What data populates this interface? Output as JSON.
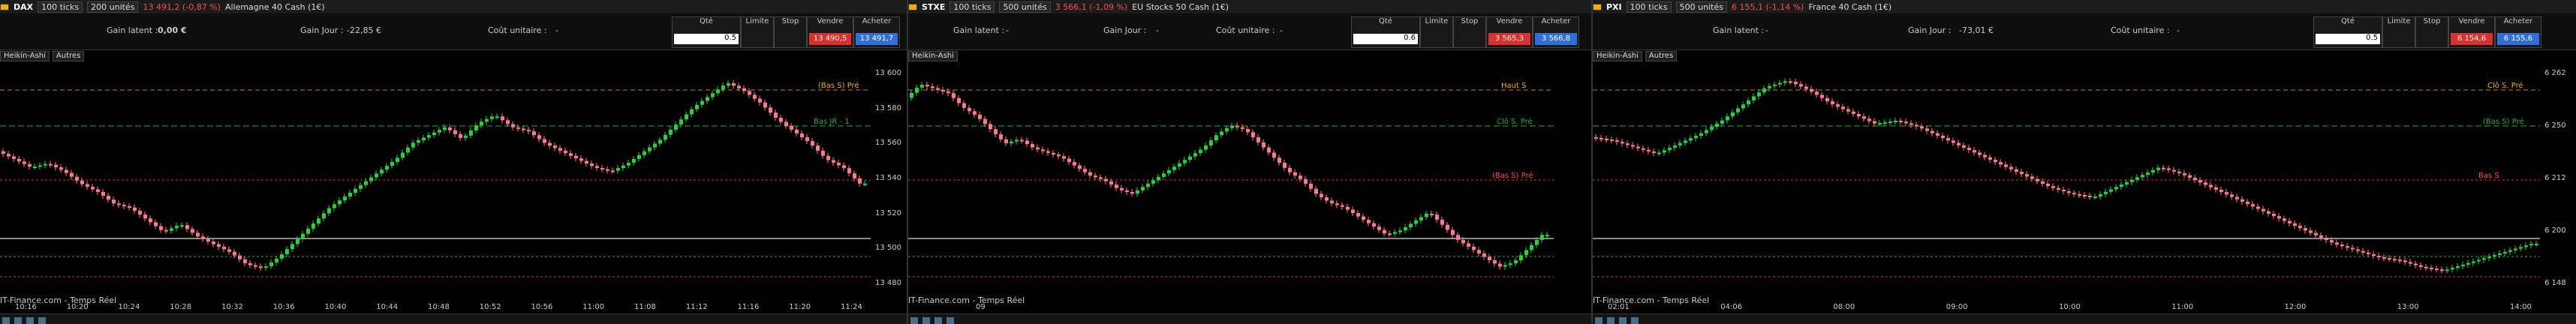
{
  "panels": [
    {
      "symbol": "DAX",
      "ticks": "100 ticks",
      "units": "200 unités",
      "quote": "13 491,2 (-0,87 %)",
      "instrument": "Allemagne 40 Cash (1€)",
      "gain_latent_label": "Gain latent :",
      "gain_latent": "0,00 €",
      "gain_jour_label": "Gain Jour :",
      "gain_jour": "-22,85 €",
      "cout_label": "Coût unitaire :",
      "cout": "-",
      "qte_label": "Qté",
      "qte": "0.5",
      "limite": "Limite",
      "stop": "Stop",
      "vendre": "Vendre",
      "acheter": "Acheter",
      "vendre_price": "13 490,5",
      "acheter_price": "13 491,7",
      "tab1": "Heikin-Ashi",
      "tab2": "Autres",
      "footer": "IT-Finance.com - Temps Réel",
      "times": [
        "10:16",
        "10:20",
        "10:24",
        "10:28",
        "10:32",
        "10:36",
        "10:40",
        "10:44",
        "10:48",
        "10:52",
        "10:56",
        "11:00",
        "11:08",
        "11:12",
        "11:16",
        "11:20",
        "11:24"
      ],
      "prices": [
        "13 600",
        "13 580",
        "13 560",
        "13 540",
        "13 520",
        "13 500",
        "13 480"
      ],
      "annotations": [
        "(Bas S) Pré",
        "Bas JR - 1"
      ],
      "series": [
        13556,
        13552,
        13548,
        13550,
        13546,
        13540,
        13536,
        13530,
        13528,
        13522,
        13516,
        13520,
        13514,
        13510,
        13506,
        13500,
        13498,
        13504,
        13512,
        13520,
        13528,
        13534,
        13540,
        13546,
        13552,
        13560,
        13564,
        13568,
        13562,
        13570,
        13574,
        13568,
        13566,
        13560,
        13556,
        13552,
        13548,
        13546,
        13550,
        13556,
        13562,
        13570,
        13578,
        13584,
        13590,
        13586,
        13580,
        13572,
        13566,
        13560,
        13552,
        13548,
        13540
      ]
    },
    {
      "symbol": "STXE",
      "ticks": "100 ticks",
      "units": "500 unités",
      "quote": "3 566,1 (-1,09 %)",
      "instrument": "EU Stocks 50 Cash (1€)",
      "gain_latent_label": "Gain latent :",
      "gain_latent": "-",
      "gain_jour_label": "Gain Jour :",
      "gain_jour": "-",
      "cout_label": "Coût unitaire :",
      "cout": "-",
      "qte_label": "Qté",
      "qte": "0.6",
      "limite": "Limite",
      "stop": "Stop",
      "vendre": "Vendre",
      "acheter": "Acheter",
      "vendre_price": "3 565,3",
      "acheter_price": "3 566,8",
      "tab1": "Heikin-Ashi",
      "tab2": "",
      "footer": "IT-Finance.com - Temps Réel",
      "times": [
        "09"
      ],
      "prices": [],
      "annotations": [
        "Haut S",
        "Clô S. Pré",
        "(Bas S) Pré"
      ],
      "series": [
        3626,
        3632,
        3630,
        3628,
        3622,
        3618,
        3612,
        3606,
        3608,
        3604,
        3602,
        3600,
        3596,
        3592,
        3590,
        3586,
        3584,
        3588,
        3592,
        3596,
        3600,
        3604,
        3610,
        3614,
        3612,
        3606,
        3600,
        3594,
        3590,
        3584,
        3580,
        3578,
        3574,
        3570,
        3566,
        3568,
        3572,
        3576,
        3570,
        3564,
        3560,
        3556,
        3552,
        3554,
        3560,
        3566
      ]
    },
    {
      "symbol": "PXI",
      "ticks": "100 ticks",
      "units": "500 unités",
      "quote": "6 155,1 (-1,14 %)",
      "instrument": "France 40 Cash (1€)",
      "gain_latent_label": "Gain latent :",
      "gain_latent": "-",
      "gain_jour_label": "Gain Jour :",
      "gain_jour": "-73,01 €",
      "cout_label": "Coût unitaire :",
      "cout": "-",
      "qte_label": "Qté",
      "qte": "0.5",
      "limite": "Limite",
      "stop": "Stop",
      "vendre": "Vendre",
      "acheter": "Acheter",
      "vendre_price": "6 154,6",
      "acheter_price": "6 155,6",
      "tab1": "Heikin-Ashi",
      "tab2": "Autres",
      "footer": "IT-Finance.com - Temps Réel",
      "times": [
        "02:01",
        "04:06",
        "08:00",
        "09:00",
        "10:00",
        "11:00",
        "12:00",
        "13:00",
        "14:00"
      ],
      "prices": [
        "6 262",
        "6 250",
        "6 212",
        "6 200",
        "6 148"
      ],
      "annotations": [
        "Clô S. Pré",
        "(Bas S) Pré",
        "Bas S"
      ],
      "series": [
        6230,
        6228,
        6224,
        6220,
        6226,
        6232,
        6240,
        6250,
        6260,
        6264,
        6258,
        6250,
        6244,
        6238,
        6240,
        6236,
        6230,
        6224,
        6218,
        6212,
        6206,
        6200,
        6196,
        6194,
        6200,
        6206,
        6212,
        6208,
        6202,
        6196,
        6190,
        6184,
        6178,
        6172,
        6166,
        6162,
        6158,
        6156,
        6152,
        6150,
        6154,
        6158,
        6162,
        6166
      ]
    }
  ]
}
